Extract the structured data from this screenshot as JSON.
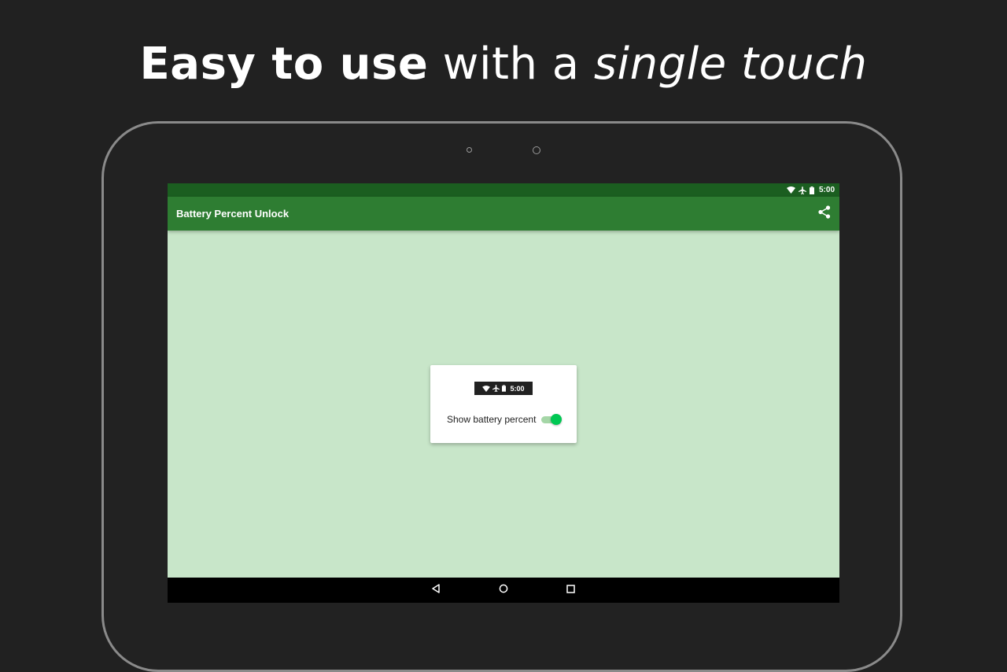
{
  "headline": {
    "part_bold": "Easy to use",
    "part_regular": " with a ",
    "part_italic": "single touch"
  },
  "device": {
    "status_bar": {
      "time": "5:00",
      "icons": [
        "wifi-icon",
        "airplane-icon",
        "battery-icon"
      ]
    },
    "app_bar": {
      "title": "Battery Percent Unlock",
      "action_icon": "share-icon"
    },
    "card": {
      "preview_time": "5:00",
      "preview_icons": [
        "wifi-icon",
        "airplane-icon",
        "battery-icon"
      ],
      "toggle_label": "Show battery percent",
      "toggle_on": true
    },
    "nav_bar": {
      "buttons": [
        "back-icon",
        "home-icon",
        "recents-icon"
      ]
    }
  },
  "colors": {
    "background": "#212121",
    "status_bar": "#1b5e20",
    "app_bar": "#2e7d32",
    "screen_background": "#c8e6c9",
    "switch_thumb": "#00c853"
  }
}
